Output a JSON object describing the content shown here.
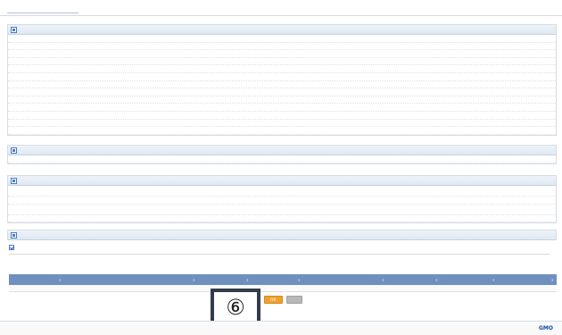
{
  "page_title": "",
  "sections": [
    {
      "title": "",
      "rows": [
        {
          "label": "",
          "value": ""
        },
        {
          "label": "",
          "value": ""
        },
        {
          "label": "",
          "value": ""
        },
        {
          "label": "",
          "value": ""
        },
        {
          "label": "",
          "value": ""
        },
        {
          "label": "",
          "value": ""
        },
        {
          "label": "",
          "value": ""
        },
        {
          "label": "",
          "value": ""
        },
        {
          "label": "",
          "value": ""
        },
        {
          "label": "",
          "value": ""
        },
        {
          "label": "",
          "value": ""
        },
        {
          "label": "",
          "value": ""
        },
        {
          "label": "",
          "value": ""
        }
      ]
    },
    {
      "title": "",
      "rows": [
        {
          "label": "",
          "value": ""
        }
      ]
    },
    {
      "title": "",
      "rows": [
        {
          "label": "",
          "value_lines": [
            "",
            ""
          ]
        },
        {
          "label": "",
          "value_lines": [
            ""
          ]
        },
        {
          "label": "",
          "value_lines": [
            "",
            ""
          ]
        },
        {
          "label": "",
          "value_lines": [
            ""
          ]
        }
      ]
    },
    {
      "title": ""
    }
  ],
  "send_settings": {
    "checkbox_label": "",
    "note": ""
  },
  "table": {
    "headers": [
      "",
      "",
      "",
      "",
      "",
      "",
      "",
      "",
      ""
    ],
    "rows": [
      [
        "",
        "",
        "",
        "",
        "",
        "",
        "",
        "",
        ""
      ]
    ]
  },
  "buttons": {
    "ok": "OK",
    "cancel": ""
  },
  "callout": "⑥",
  "footer": {
    "left": "",
    "center": "",
    "brand": "GMO",
    "brand_tail": ""
  },
  "colors": {
    "accent": "#4a7bbf",
    "table_header": "#6f8fbf",
    "ok_button": "#f0a030",
    "warning_text": "#dd2222"
  }
}
